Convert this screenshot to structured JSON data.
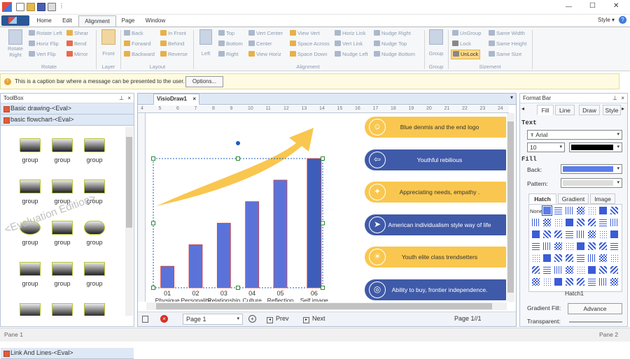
{
  "window": {
    "style_label": "Style ▾",
    "minimize": "—",
    "maximize": "☐",
    "close": "✕"
  },
  "tabs": [
    "Home",
    "Edit",
    "Alignment",
    "Page",
    "Window"
  ],
  "ribbon": {
    "rotate": {
      "big": "Rotate Right",
      "items": [
        "Rotate Left",
        "Horiz Flip",
        "Vert Flip",
        "Shear",
        "Bend",
        "Mirror"
      ],
      "group": "Rotate"
    },
    "layer": {
      "big": "Front",
      "group": "Layer"
    },
    "layout": {
      "items": [
        "Back",
        "Forward",
        "Backward",
        "In Front",
        "Behind",
        "Reverse"
      ],
      "group": "Layout"
    },
    "alignment": {
      "big": "Left",
      "items": [
        "Top",
        "Bottom",
        "Right",
        "Vert Center",
        "Center",
        "View Horiz",
        "View Vert",
        "Space Across",
        "Space Down",
        "Horiz Link",
        "Vert Link",
        "Nudge Left",
        "Nudge Right",
        "Nudge Top",
        "Nudge Bottom"
      ],
      "group": "Alignment"
    },
    "group": {
      "big": "Group",
      "group": "Group"
    },
    "sizement": {
      "items": [
        "UnGroup",
        "Lock",
        "UnLock",
        "Same Width",
        "Same Height",
        "Same Size"
      ],
      "group": "Sizement"
    }
  },
  "caption": {
    "text": "This is a caption bar where a message can be presented to the user.",
    "button": "Options..."
  },
  "toolbox": {
    "title": "ToolBox",
    "sections": [
      "Basic drawing-<Eval>",
      "basic flowchart-<Eval>",
      "Link And Lines-<Eval>"
    ],
    "item_label": "group",
    "watermark": "<Evaluation Edition>"
  },
  "document": {
    "tab": "VisioDraw1",
    "ruler": [
      "4",
      "5",
      "6",
      "7",
      "8",
      "9",
      "10",
      "11",
      "12",
      "13",
      "14",
      "15",
      "16",
      "17",
      "18",
      "19",
      "20",
      "21",
      "22",
      "23",
      "24"
    ],
    "page_label": "Page 1",
    "prev": "Prev",
    "next": "Next",
    "page_count": "Page 1//1"
  },
  "chart_data": {
    "type": "bar",
    "categories": [
      "01 Physique",
      "02 Personality",
      "03 Relationship",
      "04 Culture",
      "05 Reflection",
      "06 Self image"
    ],
    "category_numbers": [
      "01",
      "02",
      "03",
      "04",
      "05",
      "06"
    ],
    "category_names": [
      "Physique",
      "Personality",
      "Relationship",
      "Culture",
      "Reflection",
      "Self image"
    ],
    "values": [
      1,
      2,
      3,
      4,
      5,
      6
    ]
  },
  "cards": [
    {
      "text": "Blue denmis and the end logo",
      "style": "yellow",
      "icon": "person-icon"
    },
    {
      "text": "Youthful rebilious",
      "style": "blue",
      "icon": "exit-icon"
    },
    {
      "text": "Appreciating needs, empathy .",
      "style": "yellow",
      "icon": "twitter-icon"
    },
    {
      "text": "American individualism style way of life",
      "style": "blue",
      "icon": "send-icon"
    },
    {
      "text": "Youth elite class trendsetters",
      "style": "yellow",
      "icon": "sun-icon"
    },
    {
      "text": "Ability to buy, frontier independence.",
      "style": "blue",
      "icon": "target-icon"
    }
  ],
  "formatbar": {
    "title": "Format Bar",
    "tabs": [
      "Fill",
      "Line",
      "Draw",
      "Style"
    ],
    "text_heading": "Text",
    "font": "Arial",
    "size": "10",
    "fill_heading": "Fill",
    "back_label": "Back:",
    "pattern_label": "Pattern:",
    "fill_tabs": [
      "Hatch",
      "Gradient",
      "Image"
    ],
    "none_label": "None",
    "hatch_label": "Hatch1",
    "gradient_label": "Gradient Fill:",
    "advance_button": "Advance",
    "transparent_label": "Transparent:"
  },
  "status": {
    "left": "Pane 1",
    "right": "Pane 2"
  },
  "colors": {
    "yellow": "#f9c74f",
    "blue": "#3f5aa8",
    "bar": "#5b73d9",
    "accent": "#1e5bb8"
  }
}
